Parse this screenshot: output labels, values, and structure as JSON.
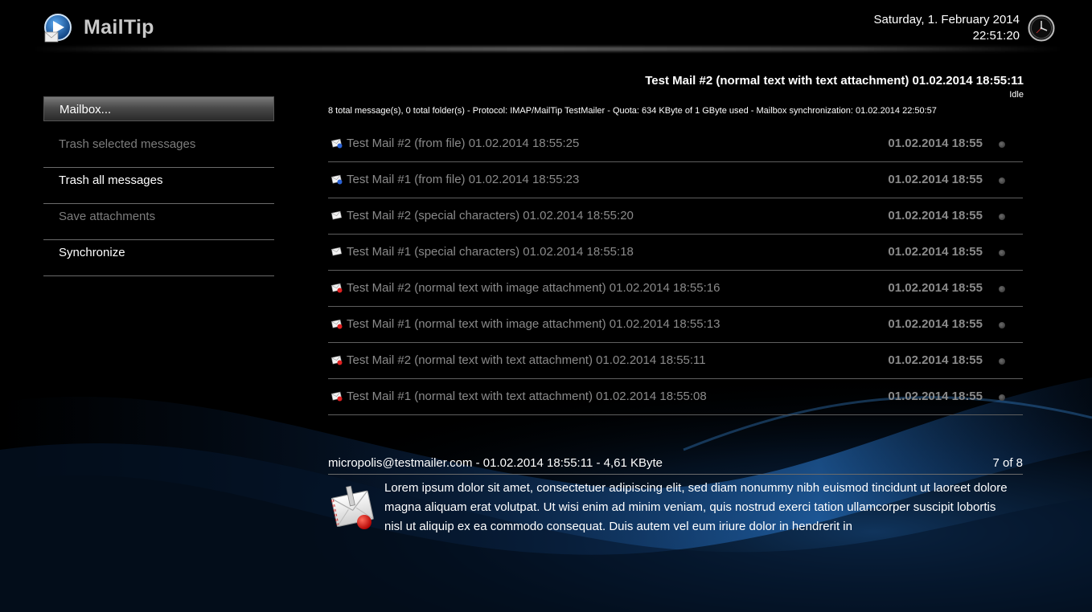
{
  "app": {
    "title": "MailTip",
    "date": "Saturday, 1. February 2014",
    "time": "22:51:20"
  },
  "sidebar": {
    "items": [
      {
        "label": "Mailbox...",
        "state": "active"
      },
      {
        "label": "Trash selected messages",
        "state": "disabled"
      },
      {
        "label": "Trash all messages",
        "state": "enabled"
      },
      {
        "label": "Save attachments",
        "state": "disabled"
      },
      {
        "label": "Synchronize",
        "state": "enabled"
      }
    ]
  },
  "message": {
    "title": "Test Mail #2 (normal text with text attachment) 01.02.2014 18:55:11",
    "status": "Idle",
    "info": "8 total message(s), 0 total folder(s) - Protocol: IMAP/MailTip TestMailer - Quota: 634 KByte of 1 GByte used - Mailbox synchronization: 01.02.2014 22:50:57"
  },
  "messages": [
    {
      "subject": "Test Mail #2 (from file) 01.02.2014 18:55:25",
      "date": "01.02.2014 18:55",
      "icon": "envelope-blue-icon"
    },
    {
      "subject": "Test Mail #1 (from file) 01.02.2014 18:55:23",
      "date": "01.02.2014 18:55",
      "icon": "envelope-blue-icon"
    },
    {
      "subject": "Test Mail #2 (special characters) 01.02.2014 18:55:20",
      "date": "01.02.2014 18:55",
      "icon": "envelope-icon"
    },
    {
      "subject": "Test Mail #1 (special characters) 01.02.2014 18:55:18",
      "date": "01.02.2014 18:55",
      "icon": "envelope-icon"
    },
    {
      "subject": "Test Mail #2 (normal text with image attachment) 01.02.2014 18:55:16",
      "date": "01.02.2014 18:55",
      "icon": "envelope-red-icon"
    },
    {
      "subject": "Test Mail #1 (normal text with image attachment) 01.02.2014 18:55:13",
      "date": "01.02.2014 18:55",
      "icon": "envelope-red-icon"
    },
    {
      "subject": "Test Mail #2 (normal text with text attachment) 01.02.2014 18:55:11",
      "date": "01.02.2014 18:55",
      "icon": "envelope-red-icon"
    },
    {
      "subject": "Test Mail #1 (normal text with text attachment) 01.02.2014 18:55:08",
      "date": "01.02.2014 18:55",
      "icon": "envelope-red-icon"
    }
  ],
  "preview": {
    "from": "micropolis@testmailer.com - 01.02.2014 18:55:11 - 4,61 KByte",
    "page": "7 of 8",
    "body": "Lorem ipsum dolor sit amet, consectetuer adipiscing elit, sed diam nonummy nibh euismod tincidunt ut laoreet dolore magna aliquam erat volutpat. Ut wisi enim ad minim veniam, quis nostrud exerci tation ullamcorper suscipit lobortis nisl ut aliquip ex ea commodo consequat. Duis autem vel eum iriure dolor in hendrerit in"
  },
  "colors": {
    "background": "#000000",
    "accent_blue": "#1e6fc0",
    "disabled_text": "#7d7d7d",
    "list_text": "#8a8a8a"
  }
}
